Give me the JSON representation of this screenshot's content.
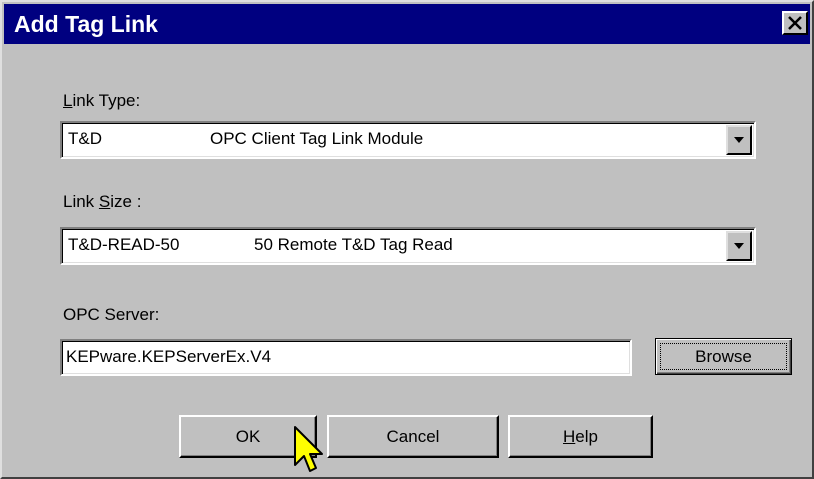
{
  "window": {
    "title": "Add Tag Link",
    "close_label": "Close"
  },
  "link_type": {
    "label_prefix": "",
    "label_mnemonic": "L",
    "label_rest": "ink Type:",
    "value": "T&D",
    "description": "OPC Client Tag Link Module"
  },
  "link_size": {
    "label_prefix": "Link ",
    "label_mnemonic": "S",
    "label_rest": "ize :",
    "value": "T&D-READ-50",
    "description": "50 Remote T&D Tag Read"
  },
  "opc_server": {
    "label": "OPC Server:",
    "value": "KEPware.KEPServerEx.V4",
    "browse_label": "Browse"
  },
  "buttons": {
    "ok": "OK",
    "cancel": "Cancel",
    "help_mnemonic": "H",
    "help_rest": "elp"
  },
  "colors": {
    "titlebar": "#000080",
    "face": "#c0c0c0",
    "cursor": "#ffff00"
  },
  "icons": {
    "close": "close-x-icon",
    "dropdown": "chevron-down-icon",
    "cursor": "arrow-cursor-icon"
  }
}
